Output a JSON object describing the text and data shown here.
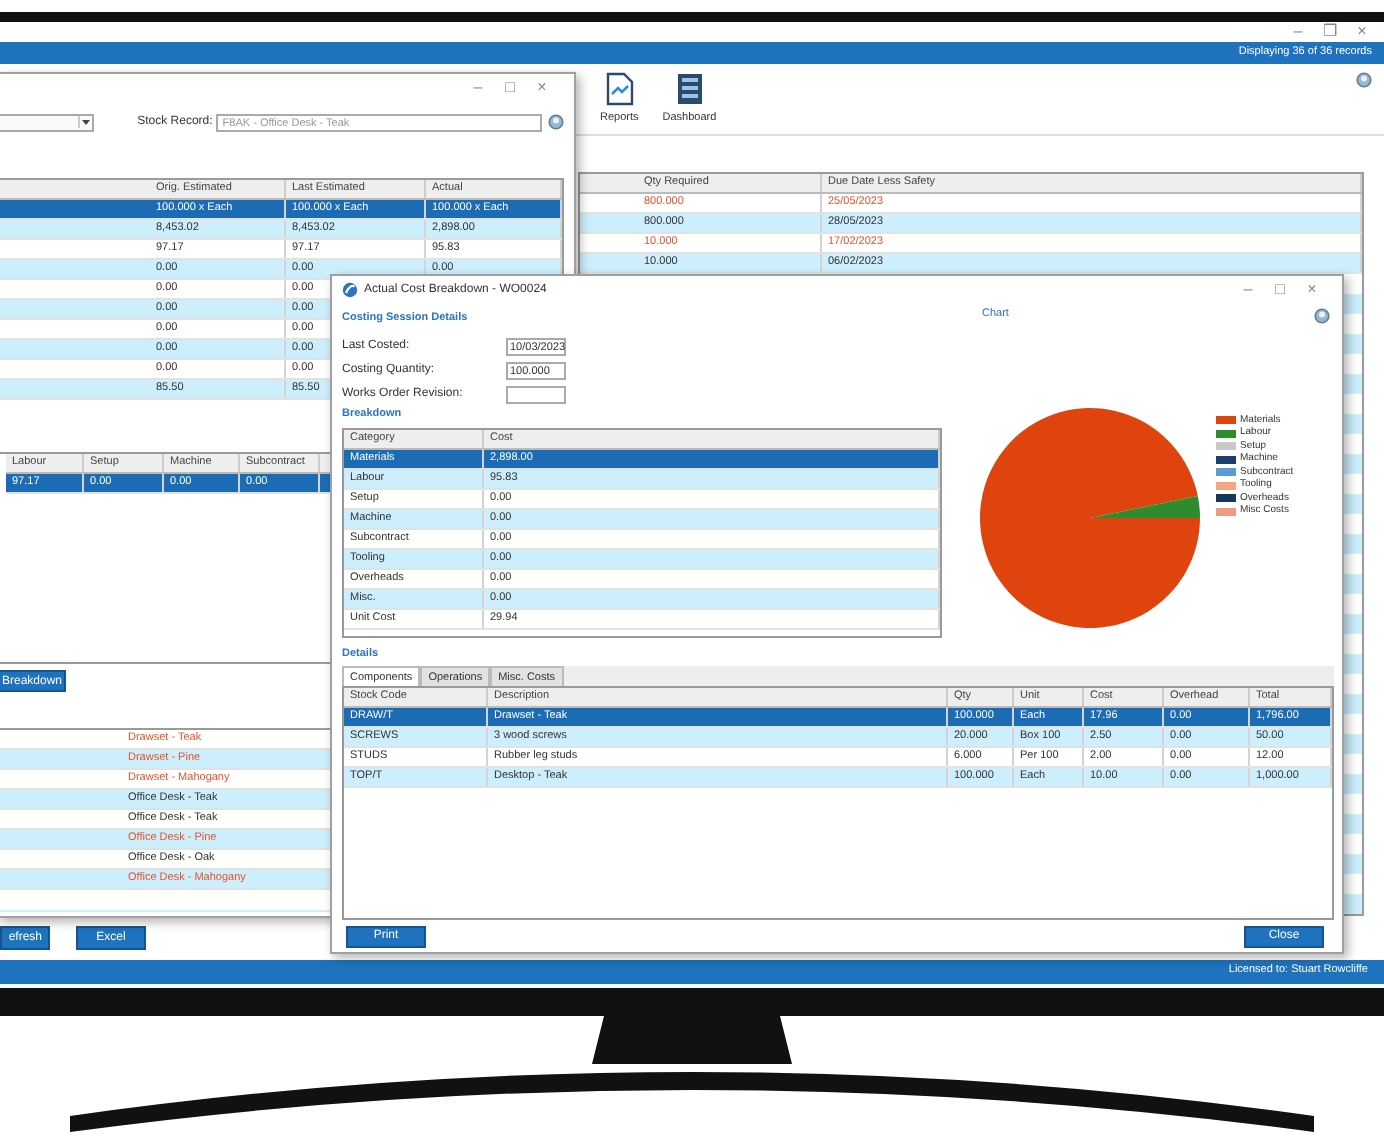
{
  "window": {
    "controls": [
      "–",
      "❐",
      "×"
    ],
    "status": "Displaying 36 of 36 records"
  },
  "toolbar": [
    {
      "kind": "reports",
      "label": "Reports"
    },
    {
      "kind": "dashboard",
      "label": "Dashboard"
    }
  ],
  "orders_table": {
    "columns": [
      "Qty Required",
      "Due Date Less Safety"
    ],
    "rows": [
      {
        "cells": [
          "800.000",
          "25/05/2023"
        ],
        "late": true
      },
      {
        "cells": [
          "800.000",
          "28/05/2023"
        ],
        "late": false
      },
      {
        "cells": [
          "10.000",
          "17/02/2023"
        ],
        "late": true
      },
      {
        "cells": [
          "10.000",
          "06/02/2023"
        ],
        "late": false
      }
    ]
  },
  "stock_window": {
    "controls": [
      "–",
      "□",
      "×"
    ],
    "stock_record_label": "Stock Record:",
    "stock_record": "F8AK - Office Desk - Teak",
    "cost_table": {
      "columns": [
        "Orig. Estimated",
        "Last Estimated",
        "Actual"
      ],
      "rows": [
        {
          "cells": [
            "100.000 x Each",
            "100.000 x Each",
            "100.000 x Each"
          ],
          "selected": true
        },
        {
          "cells": [
            "8,453.02",
            "8,453.02",
            "2,898.00"
          ],
          "selected": false
        },
        {
          "cells": [
            "97.17",
            "97.17",
            "95.83"
          ],
          "selected": false
        },
        {
          "cells": [
            "0.00",
            "0.00",
            "0.00"
          ],
          "selected": false
        },
        {
          "cells": [
            "0.00",
            "0.00"
          ],
          "selected": false
        },
        {
          "cells": [
            "0.00",
            "0.00"
          ],
          "selected": false
        },
        {
          "cells": [
            "0.00",
            "0.00"
          ],
          "selected": false
        },
        {
          "cells": [
            "0.00",
            "0.00"
          ],
          "selected": false
        },
        {
          "cells": [
            "0.00",
            "0.00"
          ],
          "selected": false
        },
        {
          "cells": [
            "85.50",
            "85.50"
          ],
          "selected": false
        }
      ]
    },
    "rates_table": {
      "columns": [
        "Labour",
        "Setup",
        "Machine",
        "Subcontract"
      ],
      "rows": [
        {
          "cells": [
            "97.17",
            "0.00",
            "0.00",
            "0.00"
          ],
          "selected": true
        }
      ]
    },
    "breakdown_button": "Breakdown",
    "items_table": {
      "rows": [
        {
          "cells": [
            "Drawset - Teak"
          ],
          "late": true
        },
        {
          "cells": [
            "Drawset - Pine"
          ],
          "late": true
        },
        {
          "cells": [
            "Drawset - Mahogany"
          ],
          "late": true
        },
        {
          "cells": [
            "Office Desk - Teak"
          ],
          "late": false
        },
        {
          "cells": [
            "Office Desk - Teak"
          ],
          "late": false
        },
        {
          "cells": [
            "Office Desk - Pine"
          ],
          "late": true
        },
        {
          "cells": [
            "Office Desk - Oak"
          ],
          "late": false
        },
        {
          "cells": [
            "Office Desk - Mahogany"
          ],
          "late": true
        }
      ]
    }
  },
  "footer_buttons": [
    "efresh",
    "Excel"
  ],
  "license": "Licensed to: Stuart Rowcliffe",
  "cost_dialog": {
    "title": "Actual Cost Breakdown - WO0024",
    "controls": [
      "–",
      "□",
      "×"
    ],
    "session_heading": "Costing Session Details",
    "fields": [
      {
        "label": "Last Costed:",
        "value": "10/03/2023"
      },
      {
        "label": "Costing Quantity:",
        "value": "100.000"
      },
      {
        "label": "Works Order Revision:"
      }
    ],
    "breakdown_heading": "Breakdown",
    "breakdown": {
      "columns": [
        "Category",
        "Cost"
      ],
      "rows": [
        {
          "cells": [
            "Materials",
            "2,898.00"
          ],
          "selected": true
        },
        {
          "cells": [
            "Labour",
            "95.83"
          ],
          "selected": false
        },
        {
          "cells": [
            "Setup",
            "0.00"
          ],
          "selected": false
        },
        {
          "cells": [
            "Machine",
            "0.00"
          ],
          "selected": false
        },
        {
          "cells": [
            "Subcontract",
            "0.00"
          ],
          "selected": false
        },
        {
          "cells": [
            "Tooling",
            "0.00"
          ],
          "selected": false
        },
        {
          "cells": [
            "Overheads",
            "0.00"
          ],
          "selected": false
        },
        {
          "cells": [
            "Misc.",
            "0.00"
          ],
          "selected": false
        },
        {
          "cells": [
            "Unit Cost",
            "29.94"
          ],
          "selected": false
        }
      ]
    },
    "chart_title": "Chart",
    "legend": [
      {
        "label": "Materials",
        "color": "#e0440e"
      },
      {
        "label": "Labour",
        "color": "#2e8b2e"
      },
      {
        "label": "Setup",
        "color": "#c8c8c8"
      },
      {
        "label": "Machine",
        "color": "#1c3f6e"
      },
      {
        "label": "Subcontract",
        "color": "#5b9bd5"
      },
      {
        "label": "Tooling",
        "color": "#f4a582"
      },
      {
        "label": "Overheads",
        "color": "#17375e"
      },
      {
        "label": "Misc Costs",
        "color": "#f09a80"
      }
    ],
    "chart_data": {
      "type": "pie",
      "values": [
        96.8,
        3.2,
        0,
        0,
        0,
        0,
        0,
        0
      ]
    },
    "details_heading": "Details",
    "tabs": [
      {
        "label": "Components",
        "selected": true
      },
      {
        "label": "Operations",
        "selected": false
      },
      {
        "label": "Misc. Costs",
        "selected": false
      }
    ],
    "components": {
      "columns": [
        "Stock Code",
        "Description",
        "Qty",
        "Unit",
        "Cost",
        "Overhead",
        "Total"
      ],
      "rows": [
        {
          "cells": [
            "DRAW/T",
            "Drawset - Teak",
            "100.000",
            "Each",
            "17.96",
            "0.00",
            "1,796.00"
          ],
          "selected": true
        },
        {
          "cells": [
            "SCREWS",
            "3 wood screws",
            "20.000",
            "Box 100",
            "2.50",
            "0.00",
            "50.00"
          ],
          "selected": false
        },
        {
          "cells": [
            "STUDS",
            "Rubber leg studs",
            "6.000",
            "Per 100",
            "2.00",
            "0.00",
            "12.00"
          ],
          "selected": false
        },
        {
          "cells": [
            "TOP/T",
            "Desktop - Teak",
            "100.000",
            "Each",
            "10.00",
            "0.00",
            "1,000.00"
          ],
          "selected": false
        }
      ]
    },
    "buttons": [
      {
        "kind": "print",
        "label": "Print"
      },
      {
        "kind": "close",
        "label": "Close"
      }
    ]
  }
}
